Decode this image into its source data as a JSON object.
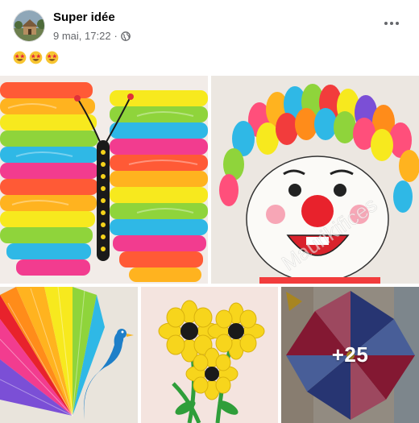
{
  "post": {
    "author": "Super idée",
    "date": "9 mai, 17:22",
    "separator": "·",
    "privacy_icon": "globe-icon",
    "caption_emojis": [
      "star-struck-emoji",
      "star-struck-emoji",
      "star-struck-emoji"
    ],
    "more_icon": "more-options-icon"
  },
  "photos": [
    {
      "subject": "paper-butterfly"
    },
    {
      "subject": "paper-clown",
      "watermark": "Maurikifices"
    },
    {
      "subject": "paper-peacock"
    },
    {
      "subject": "paper-sunflowers"
    },
    {
      "subject": "paper-pinwheel",
      "more_count": "+25"
    }
  ]
}
